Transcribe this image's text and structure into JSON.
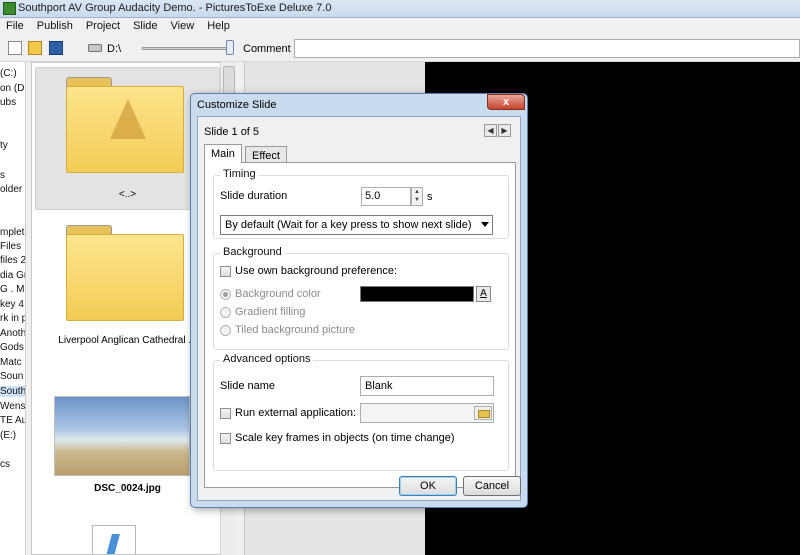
{
  "window": {
    "title": "Southport AV Group Audacity Demo. - PicturesToExe Deluxe 7.0"
  },
  "menu": [
    "File",
    "Publish",
    "Project",
    "Slide",
    "View",
    "Help"
  ],
  "toolbar": {
    "drive": "D:\\",
    "comment_label": "Comment",
    "comment_value": ""
  },
  "tree": {
    "items": [
      " (C:)",
      "on (D:",
      "ubs",
      "ty",
      "s",
      "older",
      "mplet",
      "Files",
      " files 2",
      "dia Gr",
      "G . MC",
      " key 4",
      "rk in p",
      " Anoth",
      " Gods",
      " Matc",
      " Soun",
      " South",
      " Wens",
      "TE Au",
      " (E:)",
      "cs"
    ],
    "selected_index": 17
  },
  "files": [
    {
      "caption": "<..>",
      "kind": "parent-folder"
    },
    {
      "caption": "Liverpool Anglican Cathedral ...",
      "kind": "folder"
    },
    {
      "caption": "DSC_0024.jpg",
      "kind": "image"
    }
  ],
  "dialog": {
    "title": "Customize Slide",
    "close_glyph": "x",
    "slide_of": "Slide 1 of 5",
    "tabs": [
      "Main",
      "Effect"
    ],
    "timing": {
      "label": "Timing",
      "duration_label": "Slide duration",
      "duration_value": "5.0",
      "unit": "s",
      "mode": "By default (Wait for a key press to show next slide)"
    },
    "background": {
      "label": "Background",
      "use_own_label": "Use own background preference:",
      "use_own_checked": false,
      "options": [
        "Background color",
        "Gradient filling",
        "Tiled background picture"
      ],
      "selected_option": 0,
      "color": "#000000",
      "color_button": "A"
    },
    "advanced": {
      "label": "Advanced options",
      "slide_name_label": "Slide name",
      "slide_name_value": "Blank",
      "run_external_label": "Run external application:",
      "run_external_checked": false,
      "run_external_value": "",
      "scale_label": "Scale key frames in objects (on time change)",
      "scale_checked": false
    },
    "buttons": {
      "ok": "OK",
      "cancel": "Cancel"
    }
  }
}
